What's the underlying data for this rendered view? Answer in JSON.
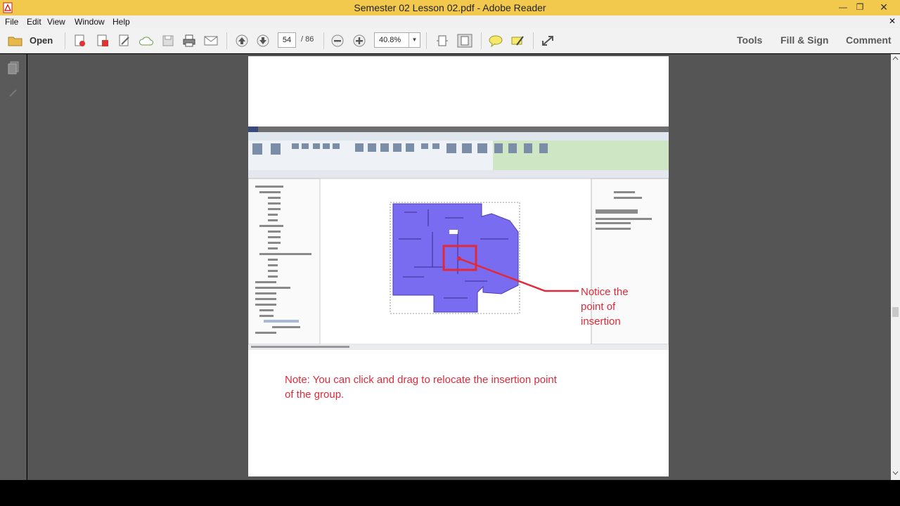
{
  "window": {
    "title": "Semester 02 Lesson 02.pdf - Adobe Reader"
  },
  "menu": {
    "items": [
      "File",
      "Edit",
      "View",
      "Window",
      "Help"
    ]
  },
  "toolbar": {
    "open_label": "Open",
    "page_current": "54",
    "page_total": "/ 86",
    "zoom": "40.8%",
    "tools_label": "Tools",
    "fill_sign_label": "Fill & Sign",
    "comment_label": "Comment"
  },
  "document": {
    "callout": [
      "Notice the",
      "point of",
      "insertion"
    ],
    "note_line1": "Note: You can click and drag to relocate the insertion point",
    "note_line2": "of the group."
  },
  "colors": {
    "title_bar": "#f2c94c",
    "accent_red": "#e02a3a",
    "floorplan": "#7a6cf0",
    "workspace": "#555555"
  }
}
